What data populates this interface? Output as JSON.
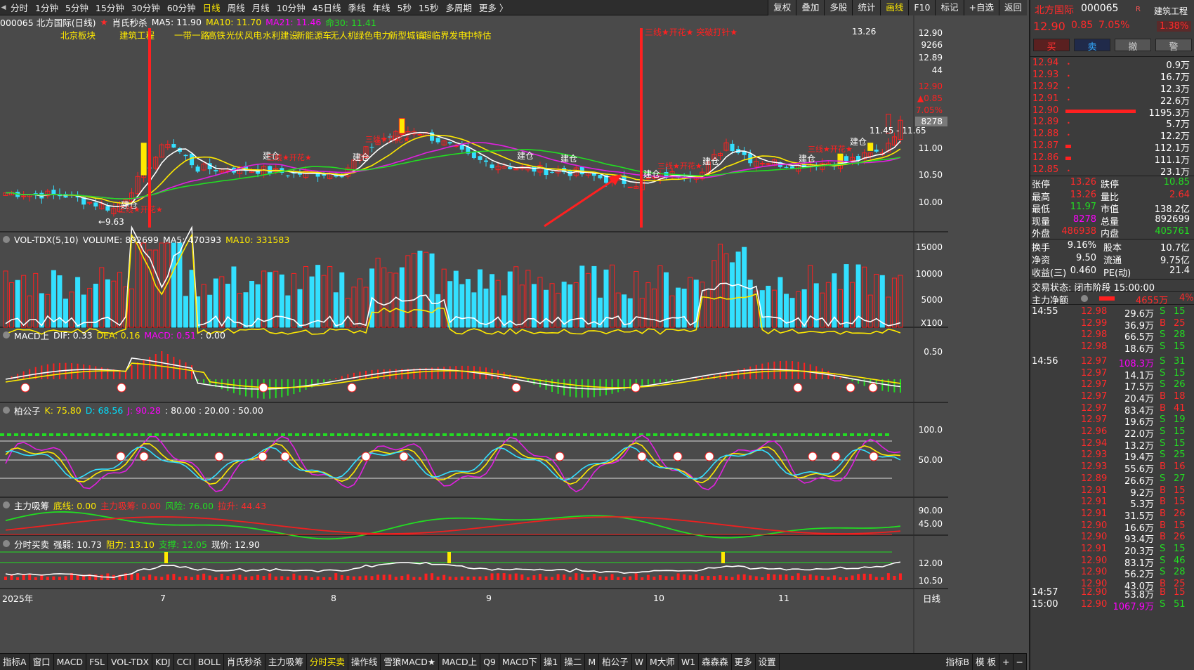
{
  "top_toolbar": {
    "periods": [
      "分时",
      "1分钟",
      "5分钟",
      "15分钟",
      "30分钟",
      "60分钟",
      "日线",
      "周线",
      "月线",
      "10分钟",
      "45日线",
      "季线",
      "年线",
      "5秒",
      "15秒",
      "多周期",
      "更多 〉"
    ],
    "active_period": "日线",
    "right_buttons": [
      "复权",
      "叠加",
      "多股",
      "统计",
      "画线",
      "F10",
      "标记",
      "+自选",
      "返回"
    ],
    "active_right": "画线"
  },
  "main_chart": {
    "title": "000065 北方国际(日线)",
    "indicator": "肖氏秒杀",
    "ma5": "MA5: 11.90",
    "ma10": "MA10: 11.70",
    "ma21": "MA21: 11.46",
    "ma30": "命30: 11.41",
    "tags": [
      "北京板块",
      "建筑工程",
      "一带一路",
      "高铁",
      "光伏",
      "风电",
      "水利建设",
      "新能源车",
      "无人机",
      "绿色电力",
      "新型城镇",
      "超临界发电",
      "中特估"
    ],
    "annotations": [
      "三线★开花★",
      "突破打针★"
    ],
    "high_label": "13.26",
    "low_label": "←9.63",
    "range_label": "11.45 - 11.65",
    "axis": [
      "12.90",
      "9266",
      "12.89",
      "44",
      "12.90",
      "▲0.85",
      "7.05%",
      "8278",
      "11.00",
      "10.50",
      "10.00"
    ],
    "jiancang": "建仓"
  },
  "x_axis": {
    "year": "2025年",
    "months": [
      "7",
      "8",
      "9",
      "10",
      "11"
    ],
    "period": "日线"
  },
  "vol_panel": {
    "name": "VOL-TDX(5,10)",
    "volume": "VOLUME: 892699",
    "ma5": "MA5: 470393",
    "ma10": "MA10: 331583",
    "axis": [
      "15000",
      "10000",
      "5000",
      "X100"
    ]
  },
  "macd_panel": {
    "name": "MACD上",
    "dif": "DIF: 0.33",
    "dea": "DEA: 0.16",
    "macd": "MACD: 0.51",
    "zero": ": 0.00",
    "axis": [
      "0.50"
    ]
  },
  "kdj_panel": {
    "name": "柏公子",
    "k": "K: 75.80",
    "d": "D: 68.56",
    "j": "J: 90.28",
    "levels": ": 80.00 : 20.00 : 50.00",
    "axis": [
      "100.0",
      "50.00"
    ]
  },
  "absorb_panel": {
    "name": "主力吸筹",
    "base": "底线: 0.00",
    "absorb": "主力吸筹: 0.00",
    "risk": "风险: 76.00",
    "pullup": "拉升: 44.43",
    "axis": [
      "90.00",
      "45.00"
    ]
  },
  "timeshare_panel": {
    "name": "分时买卖",
    "strength": "强弱: 10.73",
    "resistance": "阻力: 13.10",
    "support": "支撑: 12.05",
    "price": "现价: 12.90",
    "axis": [
      "12.00",
      "10.50"
    ]
  },
  "bottom_tabs": [
    "指标A",
    "窗口",
    "MACD",
    "FSL",
    "VOL-TDX",
    "KDJ",
    "CCI",
    "BOLL",
    "肖氏秒杀",
    "主力吸筹",
    "分时买卖",
    "操作线",
    "雪狼MACD★",
    "MACD上",
    "Q9",
    "MACD下",
    "操1",
    "操二",
    "M",
    "柏公子",
    "W",
    "M大师",
    "W1",
    "森森森",
    "更多",
    "设置"
  ],
  "active_bottom": "分时买卖",
  "bottom_right": [
    "指标B",
    "模 板",
    "+",
    "−"
  ],
  "quote": {
    "name": "北方国际",
    "code": "000065",
    "sector": "建筑工程",
    "price": "12.90",
    "change": "0.85",
    "pct": "7.05%",
    "ratio": "1.38%",
    "buttons": [
      "买",
      "卖",
      "撤",
      "警"
    ],
    "asks": [
      {
        "label": "卖五",
        "price": "12.94",
        "vol": "0.9万"
      },
      {
        "label": "卖四",
        "price": "12.93",
        "vol": "16.7万"
      },
      {
        "label": "卖三",
        "price": "12.92",
        "vol": "12.3万"
      },
      {
        "label": "卖二",
        "price": "12.91",
        "vol": "22.6万"
      },
      {
        "label": "卖一",
        "price": "12.90",
        "vol": "1195.3万"
      }
    ],
    "bids": [
      {
        "label": "买一",
        "price": "12.89",
        "vol": "5.7万"
      },
      {
        "label": "买二",
        "price": "12.88",
        "vol": "12.2万"
      },
      {
        "label": "买三",
        "price": "12.87",
        "vol": "112.1万"
      },
      {
        "label": "买四",
        "price": "12.86",
        "vol": "111.1万"
      },
      {
        "label": "买五",
        "price": "12.85",
        "vol": "23.1万"
      }
    ],
    "stats_left": [
      [
        "张停",
        "13.26"
      ],
      [
        "最高",
        "13.26"
      ],
      [
        "最低",
        "11.97"
      ],
      [
        "现量",
        "8278"
      ],
      [
        "外盘",
        "486938"
      ]
    ],
    "stats_right": [
      [
        "跌停",
        "10.85"
      ],
      [
        "量比",
        "2.64"
      ],
      [
        "市值",
        "138.2亿"
      ],
      [
        "总量",
        "892699"
      ],
      [
        "内盘",
        "405761"
      ]
    ],
    "info": [
      [
        "换手",
        "9.16%",
        "股本",
        "10.7亿"
      ],
      [
        "净资",
        "9.50",
        "流通",
        "9.75亿"
      ],
      [
        "收益(三)",
        "0.460",
        "PE(动)",
        "21.4"
      ]
    ],
    "status": "交易状态: 闭市阶段 15:00:00",
    "net": {
      "label": "主力净额",
      "value": "4655万",
      "pct": "4%"
    },
    "ticks": [
      {
        "time": "14:55",
        "price": "12.98",
        "vol": "29.6万",
        "bs": "S",
        "n": "15"
      },
      {
        "time": "",
        "price": "12.99",
        "vol": "36.9万",
        "bs": "B",
        "n": "25"
      },
      {
        "time": "",
        "price": "12.98",
        "vol": "66.5万",
        "bs": "S",
        "n": "28"
      },
      {
        "time": "",
        "price": "12.98",
        "vol": "18.6万",
        "bs": "S",
        "n": "15"
      },
      {
        "time": "14:56",
        "price": "12.97",
        "vol": "108.3万",
        "bs": "S",
        "n": "31"
      },
      {
        "time": "",
        "price": "12.97",
        "vol": "14.1万",
        "bs": "S",
        "n": "15"
      },
      {
        "time": "",
        "price": "12.97",
        "vol": "17.5万",
        "bs": "S",
        "n": "26"
      },
      {
        "time": "",
        "price": "12.97",
        "vol": "20.4万",
        "bs": "B",
        "n": "18"
      },
      {
        "time": "",
        "price": "12.97",
        "vol": "83.4万",
        "bs": "B",
        "n": "41"
      },
      {
        "time": "",
        "price": "12.97",
        "vol": "19.6万",
        "bs": "S",
        "n": "19"
      },
      {
        "time": "",
        "price": "12.96",
        "vol": "22.0万",
        "bs": "S",
        "n": "15"
      },
      {
        "time": "",
        "price": "12.94",
        "vol": "13.2万",
        "bs": "S",
        "n": "15"
      },
      {
        "time": "",
        "price": "12.93",
        "vol": "19.4万",
        "bs": "S",
        "n": "25"
      },
      {
        "time": "",
        "price": "12.93",
        "vol": "55.6万",
        "bs": "B",
        "n": "16"
      },
      {
        "time": "",
        "price": "12.89",
        "vol": "26.6万",
        "bs": "S",
        "n": "27"
      },
      {
        "time": "",
        "price": "12.91",
        "vol": "9.2万",
        "bs": "B",
        "n": "15"
      },
      {
        "time": "",
        "price": "12.91",
        "vol": "5.3万",
        "bs": "B",
        "n": "15"
      },
      {
        "time": "",
        "price": "12.91",
        "vol": "31.5万",
        "bs": "B",
        "n": "26"
      },
      {
        "time": "",
        "price": "12.90",
        "vol": "16.6万",
        "bs": "B",
        "n": "15"
      },
      {
        "time": "",
        "price": "12.90",
        "vol": "93.4万",
        "bs": "B",
        "n": "26"
      },
      {
        "time": "",
        "price": "12.91",
        "vol": "20.3万",
        "bs": "S",
        "n": "15"
      },
      {
        "time": "",
        "price": "12.90",
        "vol": "83.1万",
        "bs": "S",
        "n": "46"
      },
      {
        "time": "",
        "price": "12.90",
        "vol": "56.2万",
        "bs": "S",
        "n": "28"
      },
      {
        "time": "",
        "price": "12.90",
        "vol": "43.0万",
        "bs": "B",
        "n": "25"
      },
      {
        "time": "14:57",
        "price": "12.90",
        "vol": "53.8万",
        "bs": "B",
        "n": "15"
      },
      {
        "time": "15:00",
        "price": "12.90",
        "vol": "1067.9万",
        "bs": "S",
        "n": "51"
      }
    ]
  },
  "colors": {
    "up": "#ff2020",
    "down": "#33e0ff",
    "ma5": "#ffffff",
    "ma10": "#ffea00",
    "ma21": "#e020e0",
    "ma30": "#22dd22",
    "bg": "#4a4a4a"
  }
}
